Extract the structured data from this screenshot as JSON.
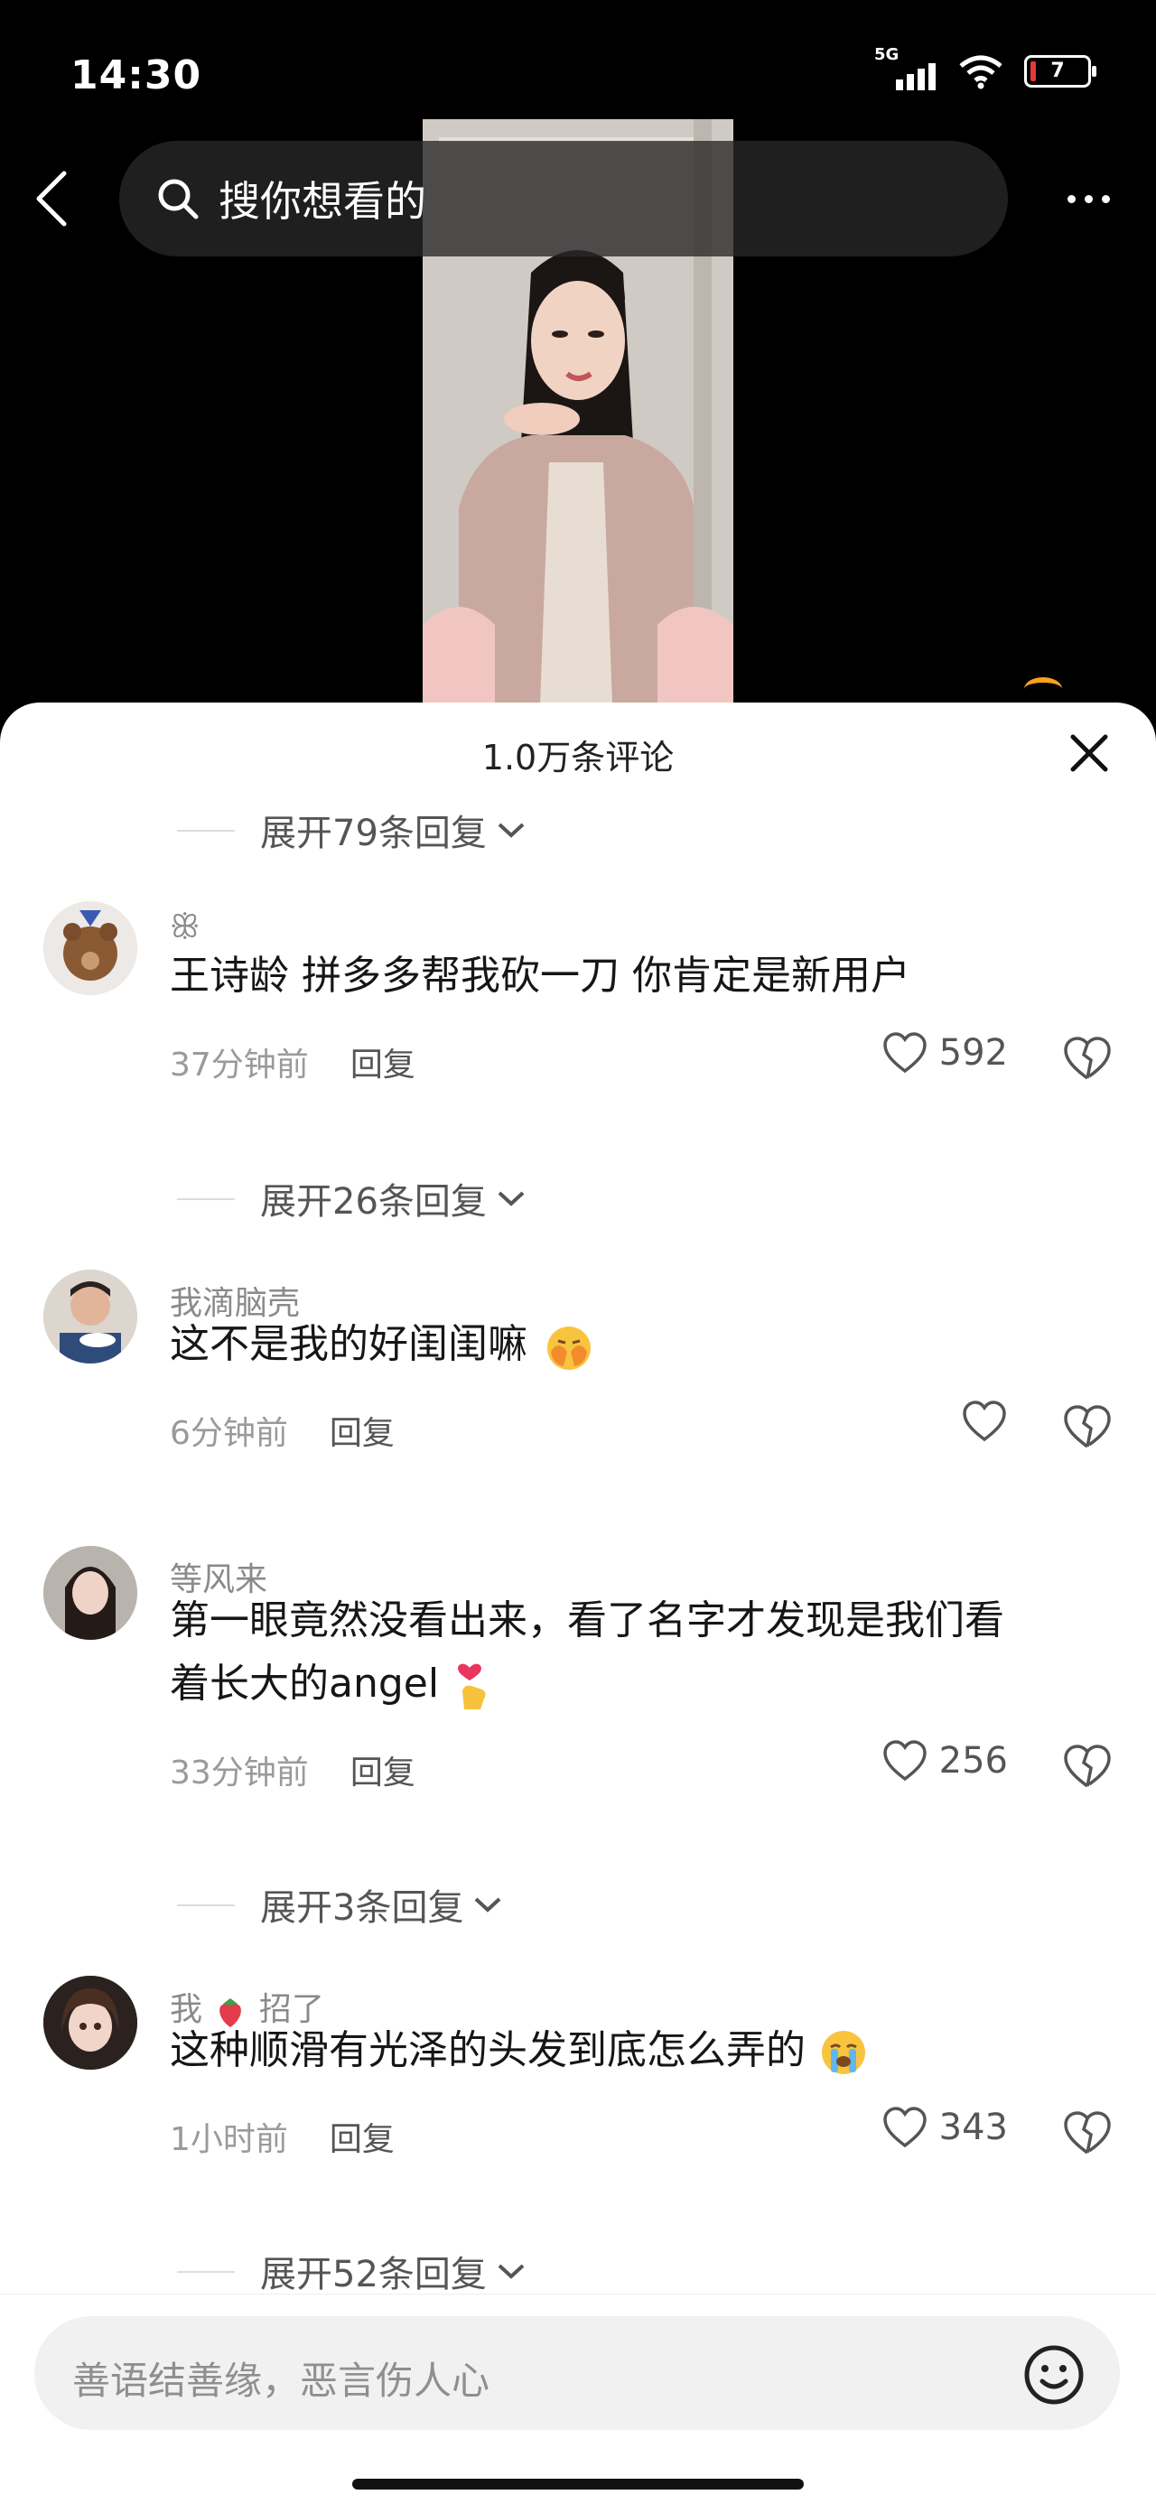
{
  "status": {
    "time": "14:30",
    "network": "5G",
    "battery": "7"
  },
  "search": {
    "placeholder": "搜你想看的"
  },
  "comments_panel": {
    "title": "1.0万条评论",
    "expand_labels": [
      "展开79条回复",
      "展开26条回复",
      "展开3条回复",
      "展开52条回复"
    ],
    "comments": [
      {
        "user": "ꕥ",
        "text": "王诗龄 拼多多帮我砍一刀 你肯定是新用户",
        "time": "37分钟前",
        "reply": "回复",
        "likes": "592"
      },
      {
        "user": "我滴脑壳",
        "text": "这不是我的好闺闺嘛",
        "emoji": "face-with-hands-emoji",
        "time": "6分钟前",
        "reply": "回复",
        "likes": ""
      },
      {
        "user": "等风来",
        "text_line1": "第一眼竟然没看出来，看了名字才发现是我们看",
        "text_line2": "着长大的angel",
        "emoji": "finger-heart-emoji",
        "time": "33分钟前",
        "reply": "回复",
        "likes": "256"
      },
      {
        "user_pre": "我",
        "user_post": "招了",
        "user_emoji": "strawberry-emoji",
        "text": "这种顺滑有光泽的头发到底怎么弄的",
        "emoji": "crying-face-emoji",
        "time": "1小时前",
        "reply": "回复",
        "likes": "343"
      }
    ]
  },
  "composer": {
    "placeholder": "善语结善缘，恶言伤人心"
  },
  "colors": {
    "accent": "#f7a21b",
    "like": "#555555"
  },
  "icons": [
    "back-icon",
    "search-icon",
    "more-icon",
    "close-icon",
    "chevron-down-icon",
    "heart-icon",
    "broken-heart-icon",
    "emoji-icon"
  ]
}
